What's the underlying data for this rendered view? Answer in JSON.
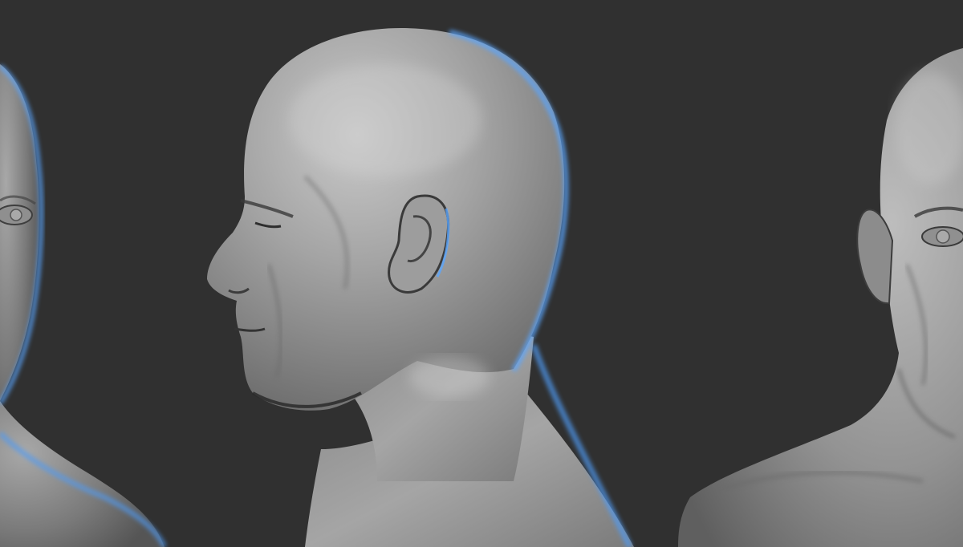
{
  "scene": {
    "background_color": "#303030",
    "sculpt_base_color": "#9c9c9c",
    "sculpt_highlight_color": "#cfcfcf",
    "sculpt_shadow_color": "#4a4a4a",
    "rim_light_color": "#5aa6ff",
    "views": [
      {
        "name": "front-three-quarter-left",
        "icon": "bust-front-icon"
      },
      {
        "name": "left-profile",
        "icon": "bust-profile-icon"
      },
      {
        "name": "front-three-quarter-right",
        "icon": "bust-front-icon"
      }
    ]
  }
}
